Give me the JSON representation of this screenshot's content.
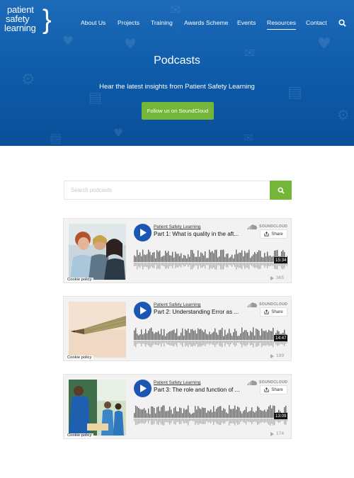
{
  "logo": {
    "line1": "patient",
    "line2": "safety",
    "line3": "learning"
  },
  "nav": {
    "items": [
      {
        "label": "About Us",
        "active": false
      },
      {
        "label": "Projects",
        "active": false
      },
      {
        "label": "Training",
        "active": false
      },
      {
        "label": "Awards Scheme",
        "active": false
      },
      {
        "label": "Events",
        "active": false
      },
      {
        "label": "Resources",
        "active": true
      },
      {
        "label": "Contact",
        "active": false
      }
    ],
    "search_icon": "search-icon"
  },
  "hero": {
    "title": "Podcasts",
    "subtitle": "Hear the latest insights from Patient Safety Learning",
    "button": "Follow us on SoundCloud"
  },
  "search": {
    "placeholder": "Search podcasts",
    "value": ""
  },
  "players": [
    {
      "uploader": "Patient Safety Learning",
      "title": "Part 1: What is quality in the aft...",
      "duration": "15:34",
      "plays": "365",
      "cookie": "Cookie policy",
      "share": "Share",
      "brand": "SOUNDCLOUD",
      "thumb": "women-talking-photo"
    },
    {
      "uploader": "Patient Safety Learning",
      "title": "Part 2: Understanding Error as ...",
      "duration": "14:47",
      "plays": "199",
      "cookie": "Cookie policy",
      "share": "Share",
      "brand": "SOUNDCLOUD",
      "thumb": "pencil-tip-photo"
    },
    {
      "uploader": "Patient Safety Learning",
      "title": "Part 3: The role and function of ...",
      "duration": "13:09",
      "plays": "174",
      "cookie": "Cookie policy",
      "share": "Share",
      "brand": "SOUNDCLOUD",
      "thumb": "nurses-photo"
    }
  ],
  "colors": {
    "hero_blue": "#0d5aa8",
    "accent_green": "#74b738",
    "play_blue": "#1b56b3"
  }
}
